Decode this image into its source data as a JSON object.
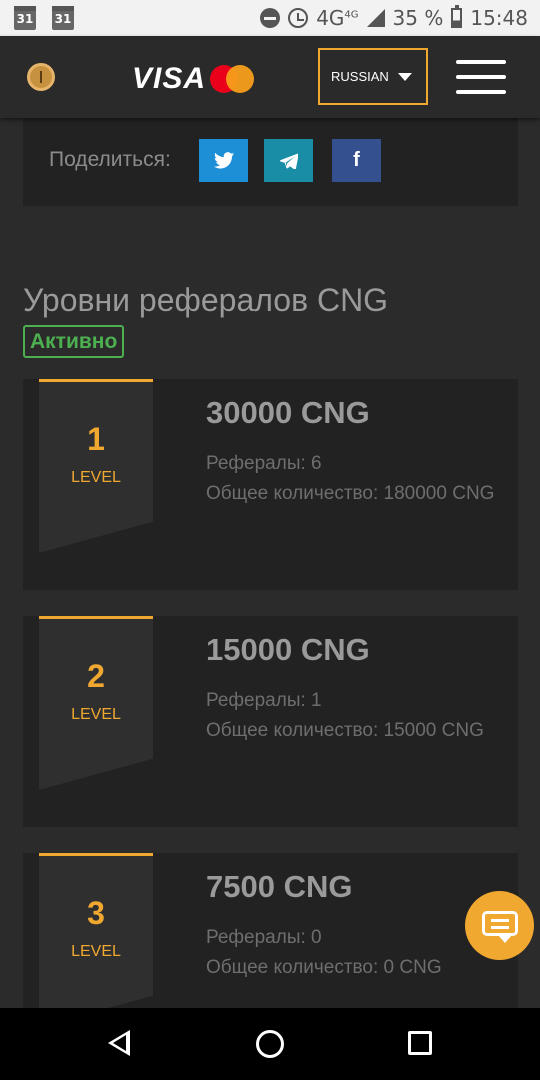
{
  "statusbar": {
    "cal1": "31",
    "cal2": "31",
    "network": "4G",
    "network_sup": "4G",
    "battery": "35 %",
    "time": "15:48"
  },
  "header": {
    "logo_text": "VISA",
    "language": "RUSSIAN"
  },
  "share": {
    "label": "Поделиться:",
    "twitter_icon": "twitter-icon",
    "telegram_icon": "telegram-icon",
    "facebook_icon": "facebook-icon"
  },
  "referrals": {
    "title": "Уровни рефералов CNG",
    "status": "Активно",
    "levels": [
      {
        "number": "1",
        "word": "LEVEL",
        "amount": "30000 CNG",
        "referrals": "Рефералы: 6",
        "total": "Общее количество: 180000 CNG"
      },
      {
        "number": "2",
        "word": "LEVEL",
        "amount": "15000 CNG",
        "referrals": "Рефералы: 1",
        "total": "Общее количество: 15000 CNG"
      },
      {
        "number": "3",
        "word": "LEVEL",
        "amount": "7500 CNG",
        "referrals": "Рефералы: 0",
        "total": "Общее количество: 0 CNG"
      }
    ]
  },
  "colors": {
    "accent": "#f0a830",
    "active": "#4caf50",
    "background": "#2b2b2b",
    "card": "#222222"
  }
}
